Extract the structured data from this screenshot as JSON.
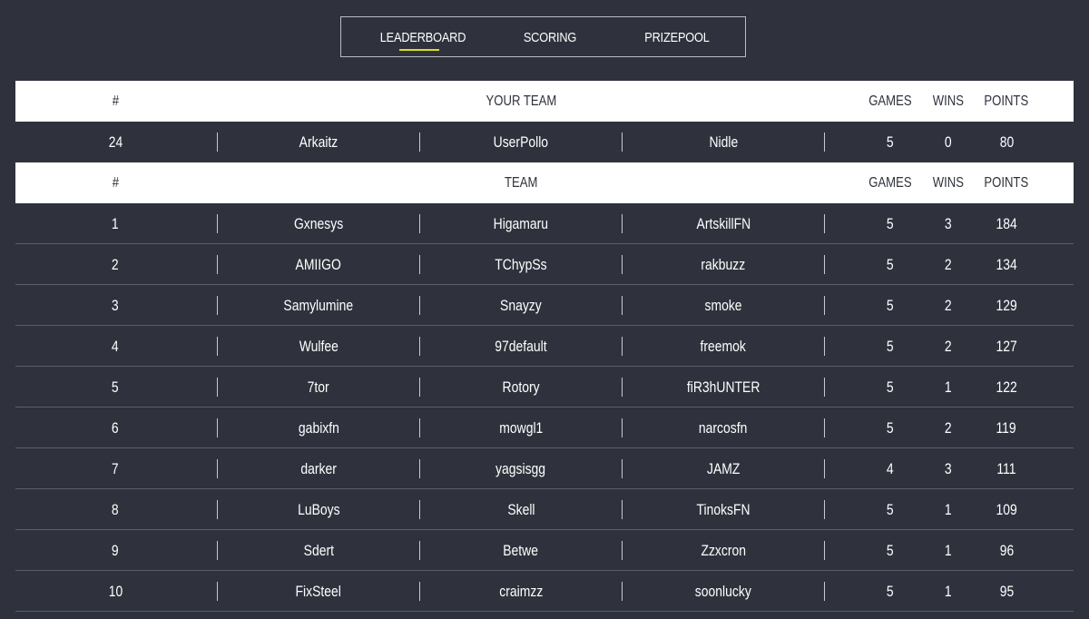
{
  "tabs": [
    {
      "label": "LEADERBOARD",
      "active": true
    },
    {
      "label": "SCORING",
      "active": false
    },
    {
      "label": "PRIZEPOOL",
      "active": false
    }
  ],
  "accent_color": "#d7e021",
  "your_team_header": {
    "rank": "#",
    "team": "YOUR TEAM",
    "games": "GAMES",
    "wins": "WINS",
    "points": "POINTS"
  },
  "your_team": {
    "rank": "24",
    "p1": "Arkaitz",
    "p2": "UserPollo",
    "p3": "Nidle",
    "games": "5",
    "wins": "0",
    "points": "80"
  },
  "leaderboard_header": {
    "rank": "#",
    "team": "TEAM",
    "games": "GAMES",
    "wins": "WINS",
    "points": "POINTS"
  },
  "rows": [
    {
      "rank": "1",
      "p1": "Gxnesys",
      "p2": "Higamaru",
      "p3": "ArtskillFN",
      "games": "5",
      "wins": "3",
      "points": "184"
    },
    {
      "rank": "2",
      "p1": "AMIIGO",
      "p2": "TChypSs",
      "p3": "rakbuzz",
      "games": "5",
      "wins": "2",
      "points": "134"
    },
    {
      "rank": "3",
      "p1": "Samylumine",
      "p2": "Snayzy",
      "p3": "smoke",
      "games": "5",
      "wins": "2",
      "points": "129"
    },
    {
      "rank": "4",
      "p1": "Wulfee",
      "p2": "97default",
      "p3": "freemok",
      "games": "5",
      "wins": "2",
      "points": "127"
    },
    {
      "rank": "5",
      "p1": "7tor",
      "p2": "Rotory",
      "p3": "fiR3hUNTER",
      "games": "5",
      "wins": "1",
      "points": "122"
    },
    {
      "rank": "6",
      "p1": "gabixfn",
      "p2": "mowgl1",
      "p3": "narcosfn",
      "games": "5",
      "wins": "2",
      "points": "119"
    },
    {
      "rank": "7",
      "p1": "darker",
      "p2": "yagsisgg",
      "p3": "JAMZ",
      "games": "4",
      "wins": "3",
      "points": "111"
    },
    {
      "rank": "8",
      "p1": "LuBoys",
      "p2": "Skell",
      "p3": "TinoksFN",
      "games": "5",
      "wins": "1",
      "points": "109"
    },
    {
      "rank": "9",
      "p1": "Sdert",
      "p2": "Betwe",
      "p3": "Zzxcron",
      "games": "5",
      "wins": "1",
      "points": "96"
    },
    {
      "rank": "10",
      "p1": "FixSteel",
      "p2": "craimzz",
      "p3": "soonlucky",
      "games": "5",
      "wins": "1",
      "points": "95"
    }
  ]
}
